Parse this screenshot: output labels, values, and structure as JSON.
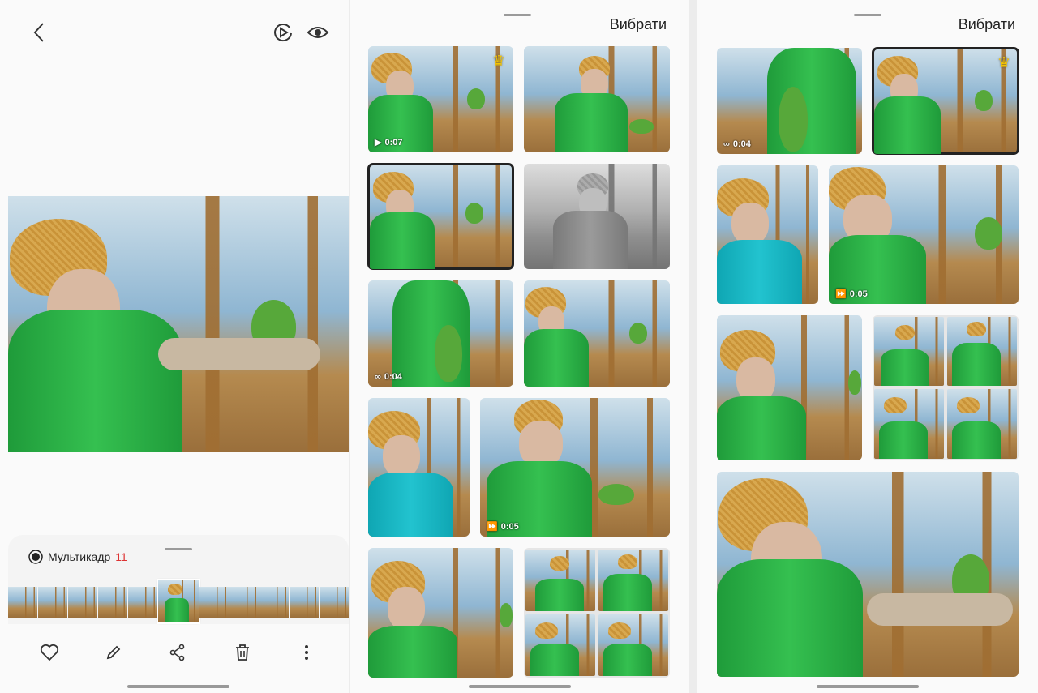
{
  "panel1": {
    "multiframe_label": "Мультикадр",
    "multiframe_count": "11",
    "top_icons": [
      "back-icon",
      "motion-photo-icon",
      "eye-icon"
    ],
    "bottom_icons": [
      "heart-icon",
      "pencil-icon",
      "share-icon",
      "trash-icon",
      "more-icon"
    ]
  },
  "panel2": {
    "select_label": "Вибрати",
    "tiles": [
      {
        "badge": "0:07",
        "badge_icon": "play-icon",
        "crown": true
      },
      {
        "badge": ""
      },
      {
        "badge": "",
        "selected": true
      },
      {
        "badge": "",
        "bw": true
      },
      {
        "badge": "0:04",
        "badge_icon": "loop-icon"
      },
      {
        "badge": ""
      },
      {
        "badge": ""
      },
      {
        "badge": "0:05",
        "badge_icon": "fast-forward-icon"
      },
      {
        "badge": ""
      },
      {
        "badge": ""
      }
    ]
  },
  "panel3": {
    "select_label": "Вибрати",
    "tiles": [
      {
        "badge": "0:04",
        "badge_icon": "loop-icon"
      },
      {
        "badge": "",
        "crown": true,
        "selected": true
      },
      {
        "badge": ""
      },
      {
        "badge": "0:05",
        "badge_icon": "fast-forward-icon"
      },
      {
        "badge": ""
      },
      {
        "badge": ""
      },
      {
        "badge": ""
      }
    ]
  },
  "colors": {
    "accent_crown": "#f5c400",
    "count_red": "#d33333",
    "vest_green": "#2fb24a",
    "vest_teal": "#1ab7c2"
  }
}
